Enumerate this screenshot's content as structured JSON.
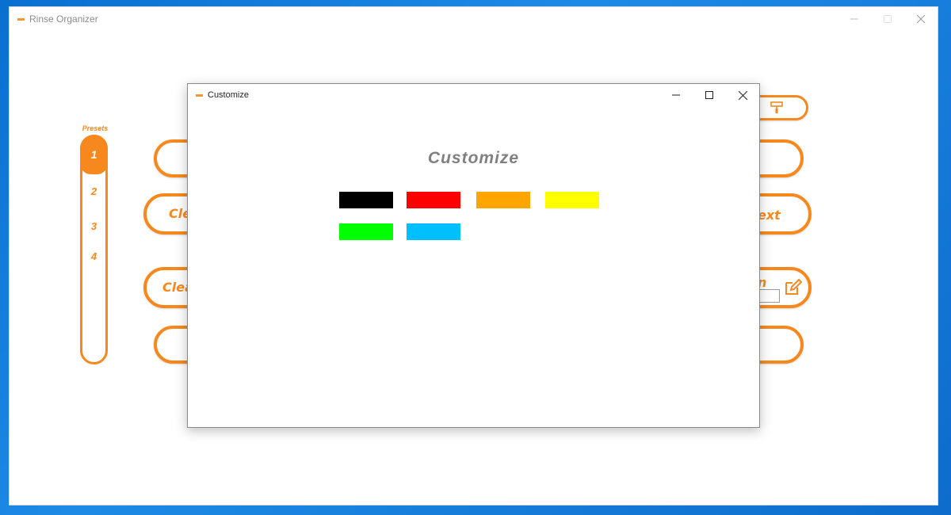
{
  "main_window": {
    "title": "Rinse Organizer",
    "presets_label": "Presets",
    "presets": [
      "1",
      "2",
      "3",
      "4"
    ],
    "buttons": [
      {
        "label": ""
      },
      {
        "label": "Cle"
      },
      {
        "label": "Clea"
      },
      {
        "label": ""
      }
    ],
    "right_buttons": [
      {
        "label": "",
        "icon": "paint-roller-icon"
      },
      {
        "label": ""
      },
      {
        "label": "ext"
      },
      {
        "label": "n",
        "icon": "edit-icon"
      },
      {
        "label": ""
      }
    ],
    "accent_color": "#f7881e"
  },
  "dialog": {
    "title": "Customize",
    "heading": "Customize",
    "swatches": [
      {
        "name": "black",
        "color": "#000000"
      },
      {
        "name": "red",
        "color": "#ff0000"
      },
      {
        "name": "orange",
        "color": "#ffa500"
      },
      {
        "name": "yellow",
        "color": "#ffff00"
      },
      {
        "name": "green",
        "color": "#00ff00"
      },
      {
        "name": "sky-blue",
        "color": "#00bfff"
      }
    ]
  }
}
